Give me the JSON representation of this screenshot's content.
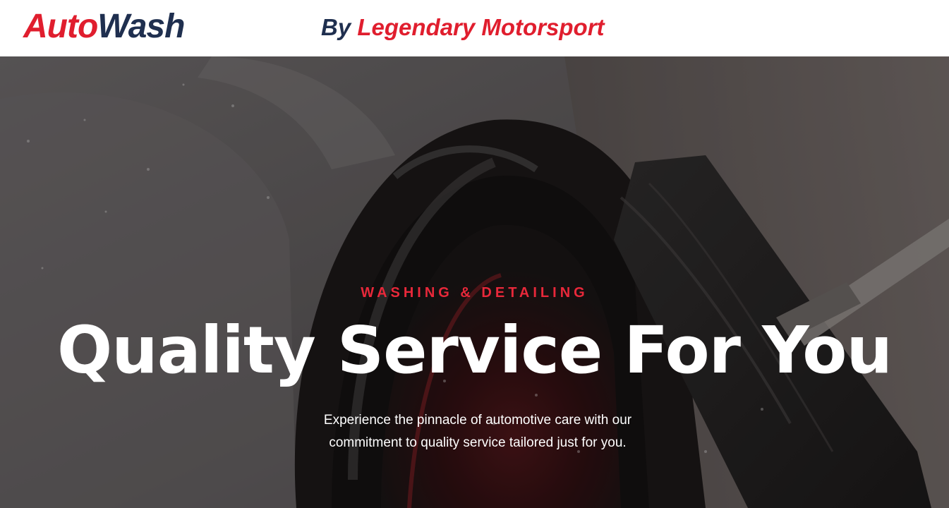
{
  "header": {
    "logo_part1": "Auto",
    "logo_part2": "Wash",
    "tagline_by": "By",
    "tagline_brand": "Legendary Motorsport"
  },
  "hero": {
    "eyebrow": "WASHING & DETAILING",
    "headline": "Quality Service For You",
    "subtext": "Experience the pinnacle of automotive care with our commitment to quality service tailored just for you.",
    "background_image": "car-wheel-washing-photo"
  },
  "colors": {
    "brand_red": "#e01e2e",
    "brand_navy": "#1f2f4f",
    "eyebrow_red": "#e8283a"
  }
}
